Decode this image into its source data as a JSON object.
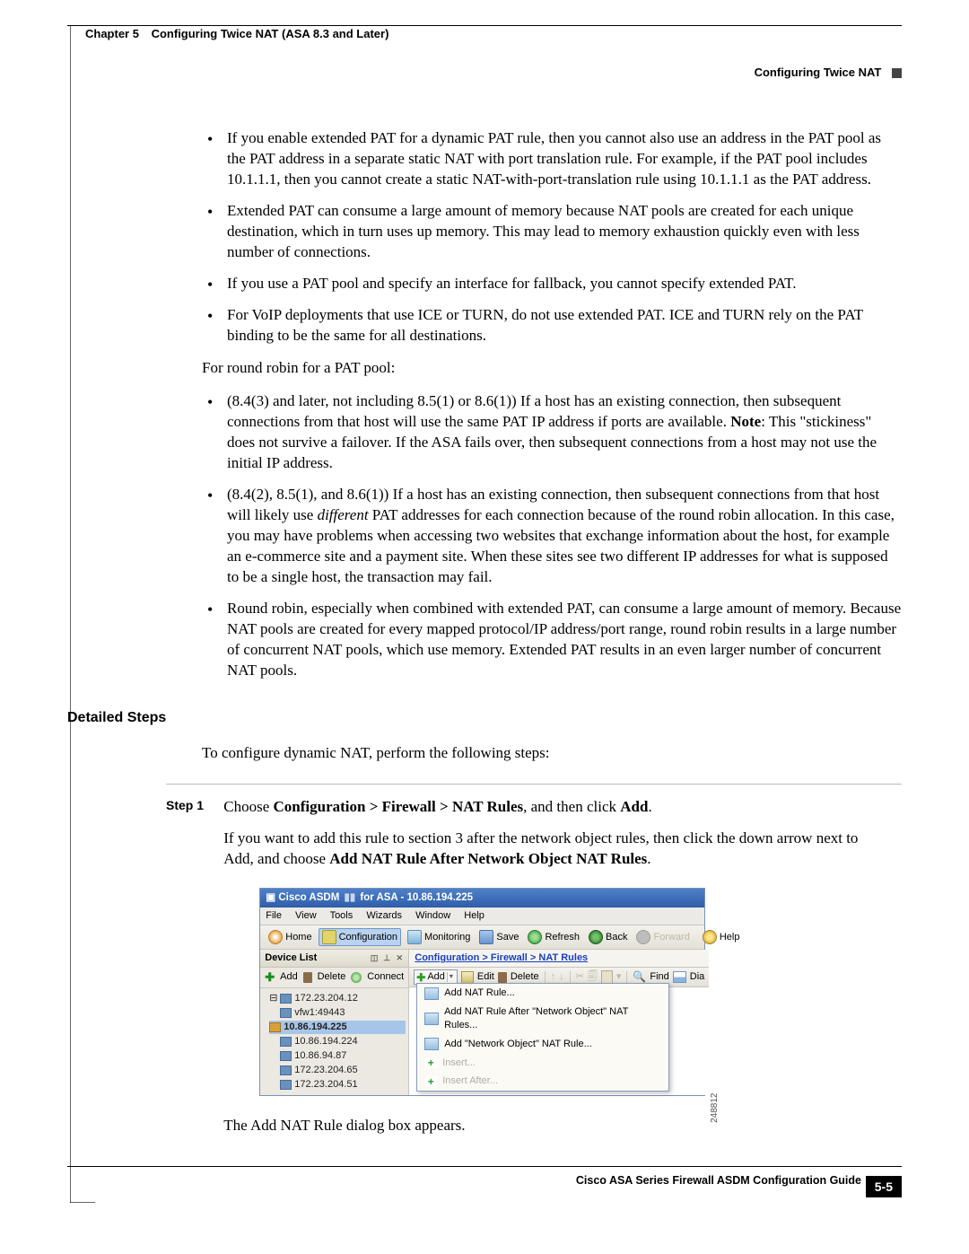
{
  "header": {
    "chapter_label": "Chapter 5",
    "chapter_title": "Configuring Twice NAT (ASA 8.3 and Later)",
    "section_title": "Configuring Twice NAT"
  },
  "body": {
    "bullets1": [
      "If you enable extended PAT for a dynamic PAT rule, then you cannot also use an address in the PAT pool as the PAT address in a separate static NAT with port translation rule. For example, if the PAT pool includes 10.1.1.1, then you cannot create a static NAT-with-port-translation rule using 10.1.1.1 as the PAT address.",
      "Extended PAT can consume a large amount of memory because NAT pools are created for each unique destination, which in turn uses up memory. This may lead to memory exhaustion quickly even with less number of connections.",
      "If you use a PAT pool and specify an interface for fallback, you cannot specify extended PAT.",
      "For VoIP deployments that use ICE or TURN, do not use extended PAT. ICE and TURN rely on the PAT binding to be the same for all destinations."
    ],
    "rr_intro": "For round robin for a PAT pool:",
    "rr_b1_pre": "(8.4(3) and later, not including 8.5(1) or 8.6(1)) If a host has an existing connection, then subsequent connections from that host will use the same PAT IP address if ports are available. ",
    "rr_b1_note": "Note",
    "rr_b1_post": ": This \"stickiness\" does not survive a failover. If the ASA fails over, then subsequent connections from a host may not use the initial IP address.",
    "rr_b2_pre": "(8.4(2), 8.5(1), and 8.6(1)) If a host has an existing connection, then subsequent connections from that host will likely use ",
    "rr_b2_em": "different",
    "rr_b2_post": " PAT addresses for each connection because of the round robin allocation. In this case, you may have problems when accessing two websites that exchange information about the host, for example an e-commerce site and a payment site. When these sites see two different IP addresses for what is supposed to be a single host, the transaction may fail.",
    "rr_b3": "Round robin, especially when combined with extended PAT, can consume a large amount of memory. Because NAT pools are created for every mapped protocol/IP address/port range, round robin results in a large number of concurrent NAT pools, which use memory. Extended PAT results in an even larger number of concurrent NAT pools.",
    "detailed_steps_heading": "Detailed Steps",
    "detailed_intro": "To configure dynamic NAT, perform the following steps:",
    "step1_label": "Step 1",
    "step1_choose_pre": "Choose ",
    "step1_choose_bold": "Configuration > Firewall > NAT Rules",
    "step1_choose_mid": ", and then click ",
    "step1_choose_add": "Add",
    "step1_choose_post": ".",
    "step1_p2_pre": "If you want to add this rule to section 3 after the network object rules, then click the down arrow next to Add, and choose ",
    "step1_p2_bold": "Add NAT Rule After Network Object NAT Rules",
    "step1_p2_post": ".",
    "after_img": "The Add NAT Rule dialog box appears."
  },
  "asdm": {
    "title_pre": "Cisco ASDM",
    "title_mid": "for ASA - ",
    "title_ip": "10.86.194.225",
    "menus": [
      "File",
      "View",
      "Tools",
      "Wizards",
      "Window",
      "Help"
    ],
    "toolbar": {
      "home": "Home",
      "config": "Configuration",
      "monitor": "Monitoring",
      "save": "Save",
      "refresh": "Refresh",
      "back": "Back",
      "forward": "Forward",
      "help": "Help"
    },
    "device_list_label": "Device List",
    "dl_buttons": {
      "add": "Add",
      "delete": "Delete",
      "connect": "Connect"
    },
    "devices": [
      "172.23.204.12",
      "vfw1:49443",
      "10.86.194.225",
      "10.86.194.224",
      "10.86.94.87",
      "172.23.204.65",
      "172.23.204.51"
    ],
    "selected_device_index": 2,
    "breadcrumb": "Configuration > Firewall > NAT Rules",
    "natbar": {
      "add": "Add",
      "edit": "Edit",
      "delete": "Delete",
      "find": "Find",
      "diag": "Dia"
    },
    "dropdown": [
      "Add NAT Rule...",
      "Add NAT Rule After \"Network Object\" NAT Rules...",
      "Add \"Network Object\" NAT Rule...",
      "Insert...",
      "Insert After..."
    ],
    "image_id": "248812"
  },
  "footer": {
    "guide": "Cisco ASA Series Firewall ASDM Configuration Guide",
    "page": "5-5"
  }
}
